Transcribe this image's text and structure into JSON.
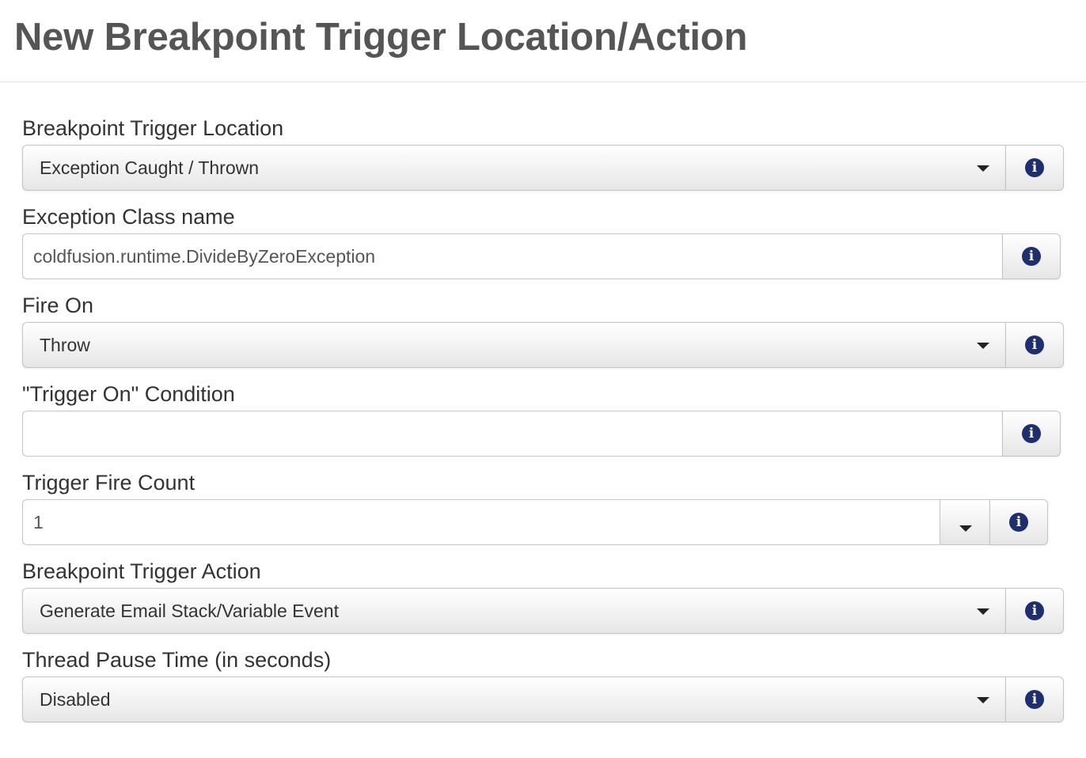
{
  "page": {
    "title": "New Breakpoint Trigger Location/Action"
  },
  "fields": {
    "trigger_location": {
      "label": "Breakpoint Trigger Location",
      "value": "Exception Caught / Thrown"
    },
    "exception_class": {
      "label": "Exception Class name",
      "value": "coldfusion.runtime.DivideByZeroException"
    },
    "fire_on": {
      "label": "Fire On",
      "value": "Throw"
    },
    "trigger_condition": {
      "label": "\"Trigger On\" Condition",
      "value": ""
    },
    "fire_count": {
      "label": "Trigger Fire Count",
      "value": "1"
    },
    "trigger_action": {
      "label": "Breakpoint Trigger Action",
      "value": "Generate Email Stack/Variable Event"
    },
    "pause_time": {
      "label": "Thread Pause Time (in seconds)",
      "value": "Disabled"
    }
  },
  "icons": {
    "info": "info-icon",
    "caret": "chevron-down-icon",
    "info_glyph": "i"
  },
  "colors": {
    "info_icon": "#1d2f6e",
    "title": "#555555"
  }
}
